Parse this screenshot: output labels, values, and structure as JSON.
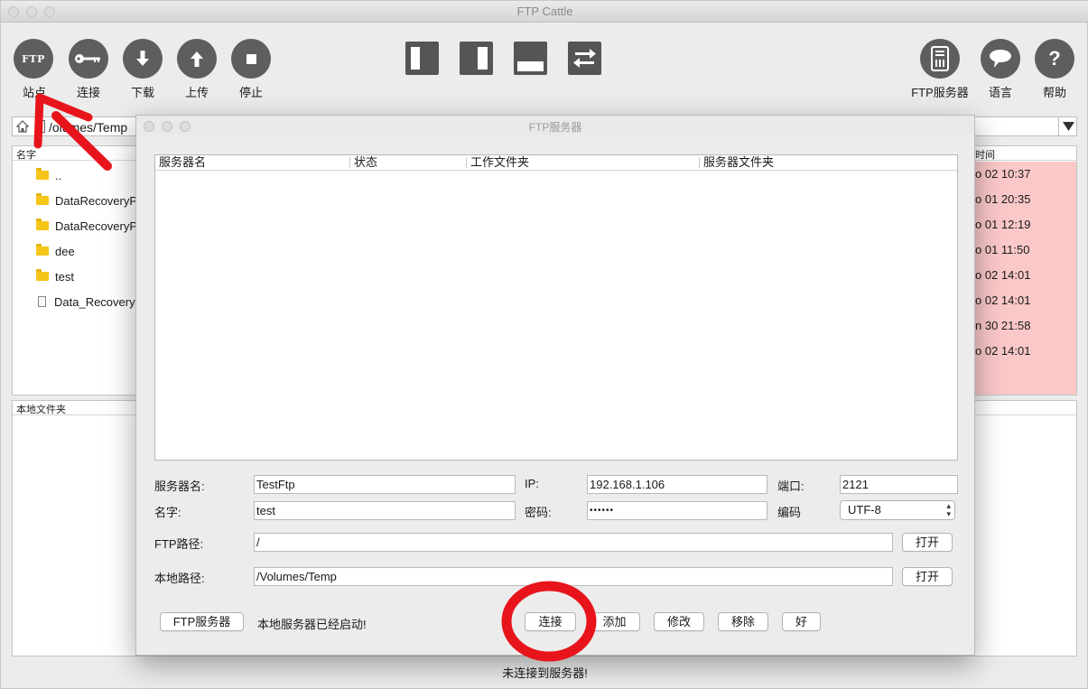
{
  "app": {
    "title": "FTP Cattle"
  },
  "toolbar": {
    "site_label": "站点",
    "site_icon_text": "FTP",
    "connect_label": "连接",
    "download_label": "下载",
    "upload_label": "上传",
    "stop_label": "停止",
    "ftp_server_label": "FTP服务器",
    "language_label": "语言",
    "help_label": "帮助"
  },
  "path_bar": {
    "value": "/Volumes/Temp"
  },
  "file_panel": {
    "name_header": "名字",
    "time_header": "修改时间",
    "files": [
      {
        "name": "..",
        "type": "folder",
        "time": "Sep 02 10:37"
      },
      {
        "name": "DataRecoveryP",
        "type": "folder",
        "time": "Sep 01 20:35"
      },
      {
        "name": "DataRecoveryP",
        "type": "folder",
        "time": "Sep 01 12:19"
      },
      {
        "name": "dee",
        "type": "folder",
        "time": "Sep 01 11:50"
      },
      {
        "name": "test",
        "type": "folder",
        "time": "Sep 02 14:01"
      },
      {
        "name": "Data_Recovery",
        "type": "file",
        "time": "Sep 02 14:01"
      },
      {
        "name": "",
        "type": "none",
        "time": "Jun 30 21:58"
      },
      {
        "name": "",
        "type": "none",
        "time": "Sep 02 14:01"
      }
    ],
    "time_rows": [
      "o 02 10:37",
      "o 01 20:35",
      "o 01 12:19",
      "o 01 11:50",
      "o 02 14:01",
      "o 02 14:01",
      "n 30 21:58",
      "o 02 14:01"
    ],
    "time_header_visible": "时间",
    "path_visible": "/olumes/Temp"
  },
  "local_panel": {
    "header": "本地文件夹"
  },
  "status": {
    "text": "未连接到服务器!"
  },
  "dialog": {
    "title": "FTP服务器",
    "columns": [
      "服务器名",
      "状态",
      "工作文件夹",
      "服务器文件夹"
    ],
    "server_name_label": "服务器名:",
    "server_name_value": "TestFtp",
    "ip_label": "IP:",
    "ip_value": "192.168.1.106",
    "port_label": "端口:",
    "port_value": "2121",
    "user_label": "名字:",
    "user_value": "test",
    "password_label": "密码:",
    "password_value": "••••••",
    "encoding_label": "编码",
    "encoding_value": "UTF-8",
    "ftp_path_label": "FTP路径:",
    "ftp_path_value": "/",
    "local_path_label": "本地路径:",
    "local_path_value": "/Volumes/Temp",
    "open_label": "打开",
    "ftp_server_button": "FTP服务器",
    "local_server_status": "本地服务器已经启动!",
    "connect_button": "连接",
    "add_button": "添加",
    "modify_button": "修改",
    "remove_button": "移除",
    "ok_button": "好"
  },
  "colors": {
    "annotation_red": "#e8141b",
    "toolbar_icon": "#5e5e5e",
    "time_highlight": "#fbc8c8"
  },
  "icons": [
    "ftp-icon",
    "key-icon",
    "download-arrow-icon",
    "upload-arrow-icon",
    "stop-icon",
    "layout-left-icon",
    "layout-right-icon",
    "layout-bottom-icon",
    "swap-icon",
    "server-icon",
    "speech-bubble-icon",
    "question-icon",
    "folder-icon",
    "file-icon",
    "home-icon",
    "dropdown-arrow-icon"
  ]
}
